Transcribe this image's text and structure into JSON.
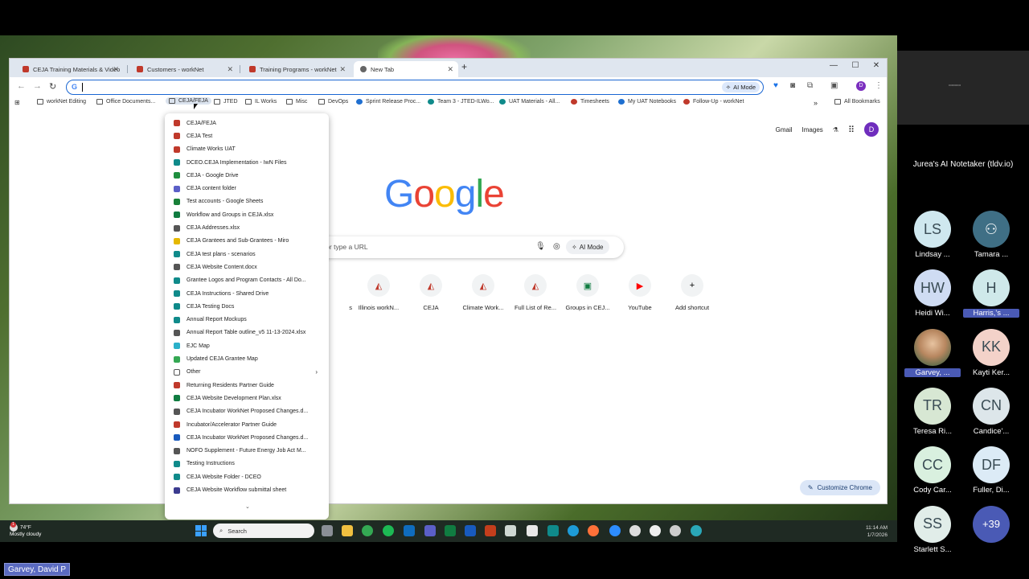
{
  "browser": {
    "tabs": [
      {
        "title": "CEJA Training Materials & Video"
      },
      {
        "title": "Customers - workNet"
      },
      {
        "title": "Training Programs - workNet"
      },
      {
        "title": "New Tab"
      }
    ],
    "new_tab_symbol": "+",
    "window_controls": {
      "minimize": "—",
      "maximize": "☐",
      "close": "✕"
    },
    "omnibox": {
      "value": "",
      "ai_mode_label": "AI Mode"
    },
    "profile_letter": "D"
  },
  "bookmarks": [
    {
      "label": "workNet Editing",
      "icon": "folder-icon"
    },
    {
      "label": "Office Documents...",
      "icon": "folder-icon"
    },
    {
      "label": "CEJA/FEJA",
      "icon": "folder-icon"
    },
    {
      "label": "JTED",
      "icon": "folder-icon"
    },
    {
      "label": "IL Works",
      "icon": "folder-icon"
    },
    {
      "label": "Misc",
      "icon": "folder-icon"
    },
    {
      "label": "DevOps",
      "icon": "folder-icon"
    },
    {
      "label": "Sprint Release Proc...",
      "icon": "jira-icon"
    },
    {
      "label": "Team 3 - JTED-ILWo...",
      "icon": "teams-icon"
    },
    {
      "label": "UAT Materials - All...",
      "icon": "sharepoint-icon"
    },
    {
      "label": "Timesheets",
      "icon": "link-icon"
    },
    {
      "label": "My UAT Notebooks",
      "icon": "onedrive-icon"
    },
    {
      "label": "Follow-Up - workNet",
      "icon": "worknet-icon"
    }
  ],
  "all_bookmarks_label": "All Bookmarks",
  "bookmark_menu": {
    "items": [
      {
        "label": "CEJA/FEJA",
        "color": "#c0392b"
      },
      {
        "label": "CEJA Test",
        "color": "#c0392b"
      },
      {
        "label": "Climate Works UAT",
        "color": "#c0392b"
      },
      {
        "label": "DCEO.CEJA Implementation - IwN Files",
        "color": "#0f8a8a"
      },
      {
        "label": "CEJA - Google Drive",
        "color": "#1e8e3e"
      },
      {
        "label": "CEJA content folder",
        "color": "#5b5fc7"
      },
      {
        "label": "Test accounts - Google Sheets",
        "color": "#188038"
      },
      {
        "label": "Workflow and Groups in CEJA.xlsx",
        "color": "#107c41"
      },
      {
        "label": "CEJA Addresses.xlsx",
        "color": "#555555"
      },
      {
        "label": "CEJA Grantees and Sub-Grantees - Miro",
        "color": "#e5b800"
      },
      {
        "label": "CEJA test plans - scenarios",
        "color": "#0f8a8a"
      },
      {
        "label": "CEJA Website Content.docx",
        "color": "#555555"
      },
      {
        "label": "Grantee Logos and Program Contacts - All Do...",
        "color": "#0f8a8a"
      },
      {
        "label": "CEJA Instructions - Shared Drive",
        "color": "#0f8a8a"
      },
      {
        "label": "CEJA Testing Docs",
        "color": "#0f8a8a"
      },
      {
        "label": "Annual Report Mockups",
        "color": "#0f8a8a"
      },
      {
        "label": "Annual Report Table outline_v5 11-13-2024.xlsx",
        "color": "#555555"
      },
      {
        "label": "EJC Map",
        "color": "#2bb0c9"
      },
      {
        "label": "Updated CEJA Grantee Map",
        "color": "#34a853"
      },
      {
        "label": "Other",
        "color": "#ffffff",
        "folder": true
      },
      {
        "label": "Returning Residents Partner Guide",
        "color": "#c0392b"
      },
      {
        "label": "CEJA Website Development Plan.xlsx",
        "color": "#107c41"
      },
      {
        "label": "CEJA Incubator WorkNet Proposed Changes.d...",
        "color": "#555555"
      },
      {
        "label": "Incubator/Accelerator Partner Guide",
        "color": "#c0392b"
      },
      {
        "label": "CEJA Incubator WorkNet Proposed Changes.d...",
        "color": "#185abd"
      },
      {
        "label": "NOFO Supplement - Future Energy Job Act M...",
        "color": "#555555"
      },
      {
        "label": "Testing Instructions",
        "color": "#0f8a8a"
      },
      {
        "label": "CEJA Website Folder - DCEO",
        "color": "#0f8a8a"
      },
      {
        "label": "CEJA Website Workflow submittal sheet",
        "color": "#3b3b8f"
      }
    ],
    "more_symbol": "⌄"
  },
  "ntp": {
    "gmail": "Gmail",
    "images": "Images",
    "avatar_letter": "D",
    "logo_letters": [
      "G",
      "o",
      "o",
      "g",
      "l",
      "e"
    ],
    "logo_colors": [
      "#4285f4",
      "#ea4335",
      "#fbbc05",
      "#4285f4",
      "#34a853",
      "#ea4335"
    ],
    "search_placeholder": "oogle or type a URL",
    "ai_mode_label": "AI Mode",
    "shortcuts": [
      {
        "label": "s",
        "glyph": ""
      },
      {
        "label": "Illinois workN...",
        "glyph": "◭"
      },
      {
        "label": "CEJA",
        "glyph": "◭"
      },
      {
        "label": "Climate Work...",
        "glyph": "◭"
      },
      {
        "label": "Full List of Re...",
        "glyph": "◭"
      },
      {
        "label": "Groups in CEJ...",
        "glyph": "▣"
      },
      {
        "label": "YouTube",
        "glyph": "▶"
      },
      {
        "label": "Add shortcut",
        "glyph": "+"
      }
    ],
    "customize_label": "Customize Chrome"
  },
  "taskbar": {
    "weather_temp": "74°F",
    "weather_desc": "Mostly cloudy",
    "weather_badge": "1",
    "search_label": "Search",
    "time": "11:14 AM",
    "date": "1/7/2026"
  },
  "meeting": {
    "notetaker": "Jurea's AI Notetaker (tldv.io)",
    "participants": [
      {
        "initials": "LS",
        "name": "Lindsay ...",
        "color": "#cfe8ef"
      },
      {
        "initials": "",
        "name": "Tamara ...",
        "color": "#3f6f85",
        "icon": true
      },
      {
        "initials": "HW",
        "name": "Heidi Wi...",
        "color": "#cfdcf3"
      },
      {
        "initials": "H",
        "name": "Harris,'s ...",
        "color": "#cfe9ea",
        "highlight": true
      },
      {
        "initials": "",
        "name": "Garvey, ...",
        "color": "#c9a27e",
        "photo": true,
        "highlight": true
      },
      {
        "initials": "KK",
        "name": "Kayti Ker...",
        "color": "#f3d2c9"
      },
      {
        "initials": "TR",
        "name": "Teresa Ri...",
        "color": "#d7e7d3"
      },
      {
        "initials": "CN",
        "name": "Candice'...",
        "color": "#dde6ea"
      },
      {
        "initials": "CC",
        "name": "Cody Car...",
        "color": "#d9f0df"
      },
      {
        "initials": "DF",
        "name": "Fuller, Di...",
        "color": "#dcebf6"
      },
      {
        "initials": "SS",
        "name": "Starlett S...",
        "color": "#e1ede9"
      },
      {
        "initials": "+39",
        "name": "",
        "color": "#4a5ab5",
        "more": true
      }
    ],
    "speaker": "Garvey, David P"
  }
}
